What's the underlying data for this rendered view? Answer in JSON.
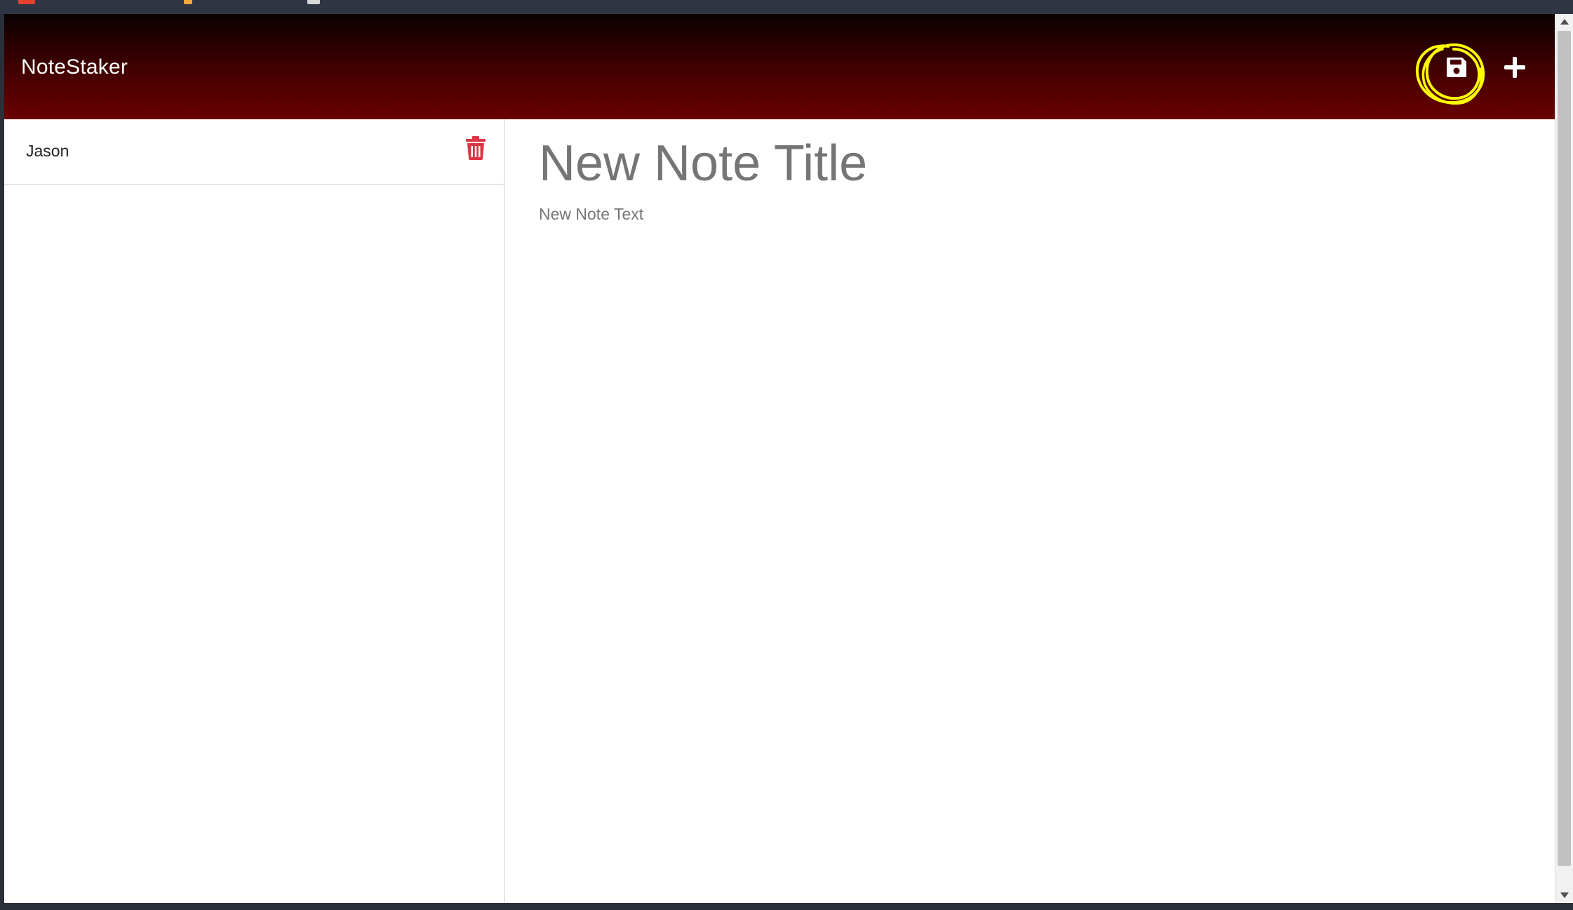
{
  "app": {
    "brand": "NoteStaker"
  },
  "toolbar": {
    "save_icon": "floppy-disk-icon",
    "new_icon": "plus-icon",
    "annotation_color": "#ffff00"
  },
  "sidebar": {
    "notes": [
      {
        "title": "Jason",
        "delete_icon": "trash-icon"
      }
    ]
  },
  "editor": {
    "title_placeholder": "New Note Title",
    "text_placeholder": "New Note Text"
  },
  "colors": {
    "navbar_top": "#0a0000",
    "navbar_bottom": "#6b0000",
    "delete_red": "#dc3545"
  }
}
